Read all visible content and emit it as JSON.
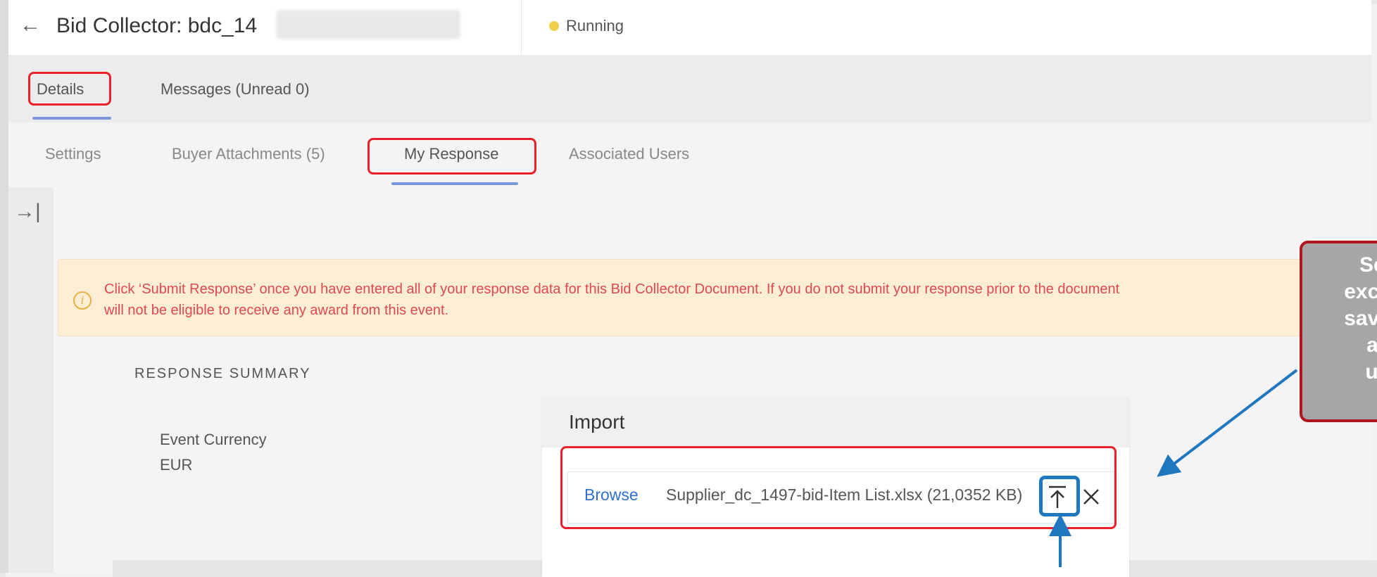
{
  "header": {
    "back_glyph": "←",
    "title": "Bid Collector: bdc_14",
    "status": "Running",
    "status_color": "#f2cf4a"
  },
  "tabs_primary": [
    {
      "label": "Details",
      "active": true
    },
    {
      "label": "Messages (Unread 0)",
      "active": false
    }
  ],
  "tabs_secondary": [
    {
      "label": "Settings",
      "active": false
    },
    {
      "label": "Buyer Attachments (5)",
      "active": false
    },
    {
      "label": "My Response",
      "active": true
    },
    {
      "label": "Associated Users",
      "active": false
    }
  ],
  "sidebar": {
    "collapse_glyph": "→|"
  },
  "alert": {
    "icon": "info-icon",
    "line1": "Click ‘Submit Response’ once you have entered all of your response data for this Bid Collector Document. If you do not submit your response prior to the document",
    "line2": "will not be eligible to receive any award from this event."
  },
  "response_summary": {
    "heading": "RESPONSE SUMMARY",
    "event_currency_label": "Event Currency",
    "event_currency_value": "EUR"
  },
  "import_dialog": {
    "title": "Import",
    "browse_label": "Browse",
    "file_name": "Supplier_dc_1497-bid-Item List.xlsx (21,0352 KB)",
    "upload_icon": "upload-icon",
    "remove_icon": "close-icon"
  },
  "callout": {
    "lines": [
      "Sel",
      "exce",
      "save",
      "an",
      "up"
    ]
  },
  "colors": {
    "accent": "#7c97dc",
    "highlight_red": "#e8212a",
    "highlight_blue": "#1f77bf",
    "alert_text": "#e0494f",
    "link": "#2f6fd1"
  }
}
